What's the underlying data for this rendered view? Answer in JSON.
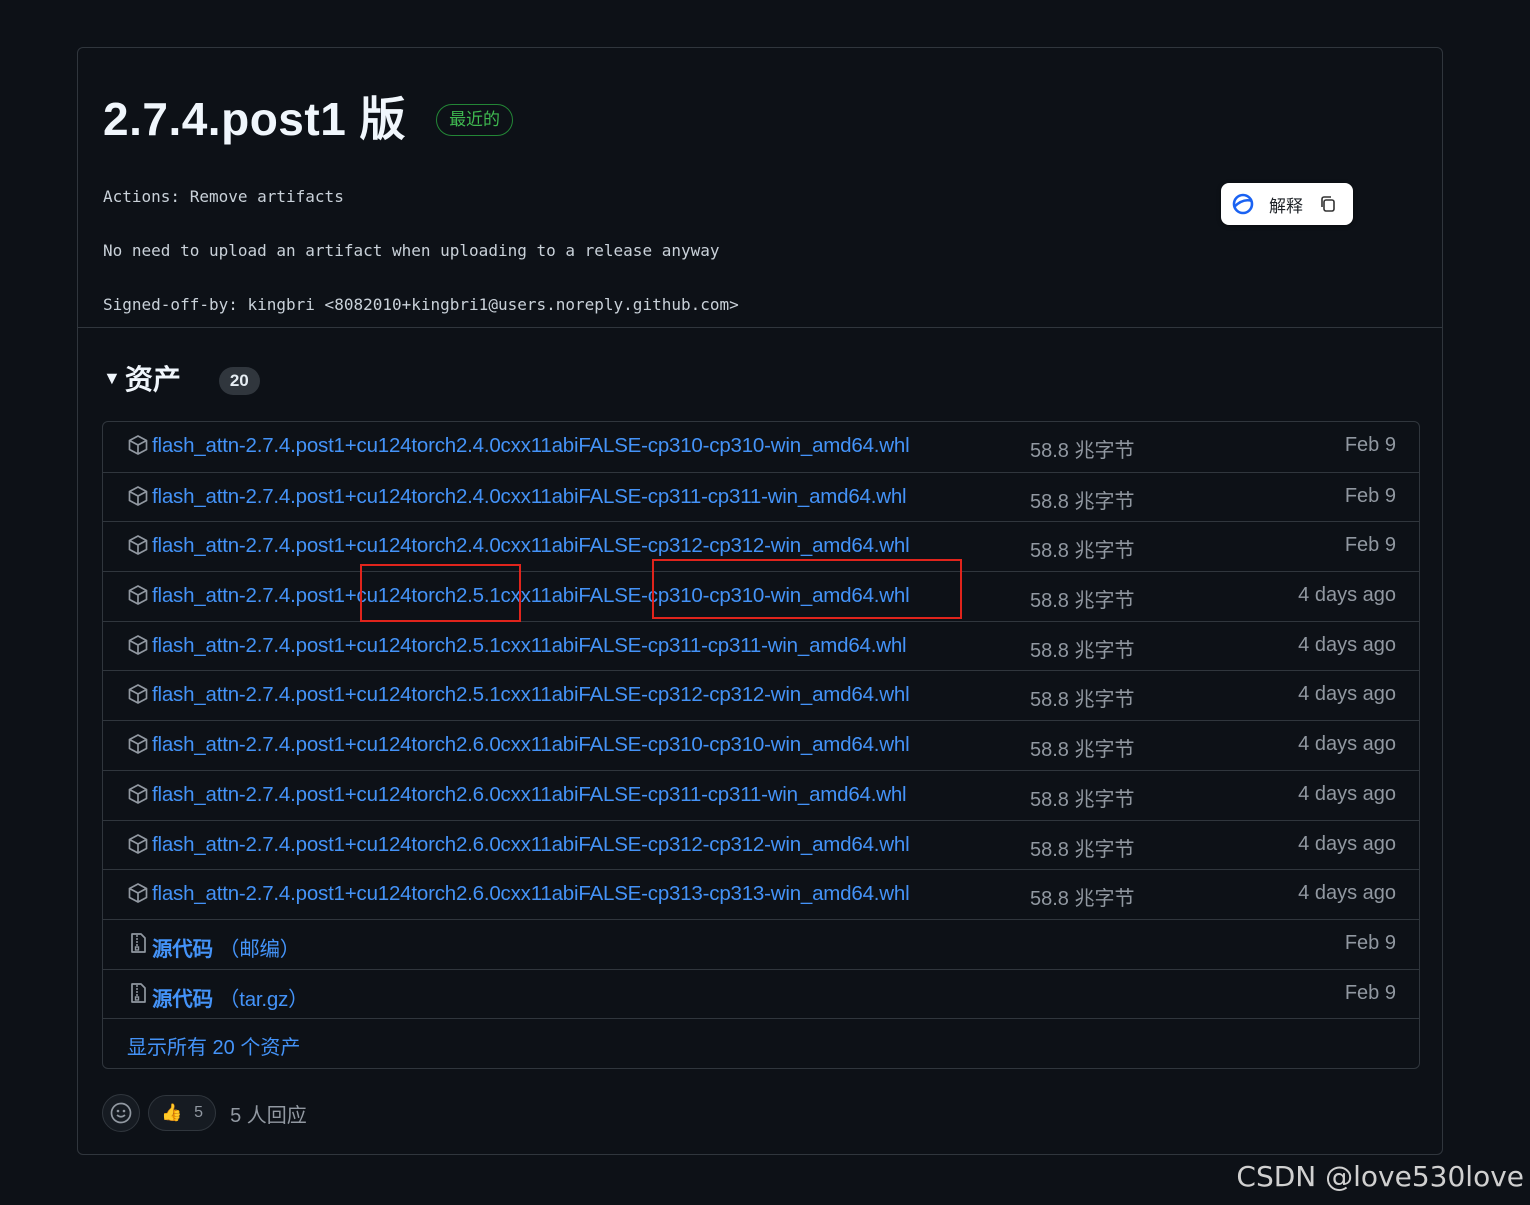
{
  "release": {
    "title": "2.7.4.post1 版",
    "latest_badge": "最近的",
    "commit_lines": [
      "Actions: Remove artifacts",
      "No need to upload an artifact when uploading to a release anyway",
      "Signed-off-by: kingbri <8082010+kingbri1@users.noreply.github.com>"
    ]
  },
  "popup": {
    "explain_label": "解释",
    "icon": "copy-icon"
  },
  "assets": {
    "heading": "资产",
    "count": "20",
    "files": [
      {
        "name": "flash_attn-2.7.4.post1+cu124torch2.4.0cxx11abiFALSE-cp310-cp310-win_amd64.whl",
        "size": "58.8 兆字节",
        "date": "Feb 9"
      },
      {
        "name": "flash_attn-2.7.4.post1+cu124torch2.4.0cxx11abiFALSE-cp311-cp311-win_amd64.whl",
        "size": "58.8 兆字节",
        "date": "Feb 9"
      },
      {
        "name": "flash_attn-2.7.4.post1+cu124torch2.4.0cxx11abiFALSE-cp312-cp312-win_amd64.whl",
        "size": "58.8 兆字节",
        "date": "Feb 9"
      },
      {
        "name": "flash_attn-2.7.4.post1+cu124torch2.5.1cxx11abiFALSE-cp310-cp310-win_amd64.whl",
        "size": "58.8 兆字节",
        "date": "4 days ago"
      },
      {
        "name": "flash_attn-2.7.4.post1+cu124torch2.5.1cxx11abiFALSE-cp311-cp311-win_amd64.whl",
        "size": "58.8 兆字节",
        "date": "4 days ago"
      },
      {
        "name": "flash_attn-2.7.4.post1+cu124torch2.5.1cxx11abiFALSE-cp312-cp312-win_amd64.whl",
        "size": "58.8 兆字节",
        "date": "4 days ago"
      },
      {
        "name": "flash_attn-2.7.4.post1+cu124torch2.6.0cxx11abiFALSE-cp310-cp310-win_amd64.whl",
        "size": "58.8 兆字节",
        "date": "4 days ago"
      },
      {
        "name": "flash_attn-2.7.4.post1+cu124torch2.6.0cxx11abiFALSE-cp311-cp311-win_amd64.whl",
        "size": "58.8 兆字节",
        "date": "4 days ago"
      },
      {
        "name": "flash_attn-2.7.4.post1+cu124torch2.6.0cxx11abiFALSE-cp312-cp312-win_amd64.whl",
        "size": "58.8 兆字节",
        "date": "4 days ago"
      },
      {
        "name": "flash_attn-2.7.4.post1+cu124torch2.6.0cxx11abiFALSE-cp313-cp313-win_amd64.whl",
        "size": "58.8 兆字节",
        "date": "4 days ago"
      }
    ],
    "source": [
      {
        "label": "源代码",
        "format": "（邮编）",
        "date": "Feb 9"
      },
      {
        "label": "源代码",
        "format": "（tar.gz）",
        "date": "Feb 9"
      }
    ],
    "show_all": "显示所有 20 个资产"
  },
  "reactions": {
    "thumbs_emoji": "👍",
    "thumbs_count": "5",
    "summary": "5 人回应"
  },
  "watermark": "CSDN @love530love",
  "colors": {
    "background": "#0d1117",
    "link": "#4493f8",
    "border": "#30363d",
    "latest_green": "#3fb950",
    "highlight_box": "#e0241c"
  }
}
